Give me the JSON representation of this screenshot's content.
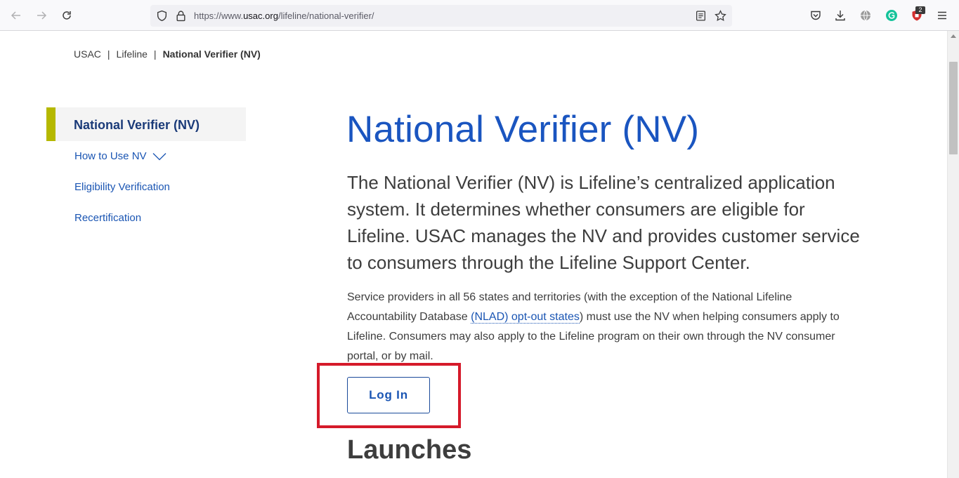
{
  "browser": {
    "url_prefix": "https://www.",
    "url_host": "usac.org",
    "url_path": "/lifeline/national-verifier/",
    "extension_badge": "2"
  },
  "breadcrumb": {
    "items": [
      "USAC",
      "Lifeline"
    ],
    "separator": "|",
    "current": "National Verifier (NV)"
  },
  "sidenav": {
    "active": "National Verifier (NV)",
    "items": [
      {
        "label": "How to Use NV"
      },
      {
        "label": "Eligibility Verification"
      },
      {
        "label": "Recertification"
      }
    ]
  },
  "main": {
    "title": "National Verifier (NV)",
    "lead": "The National Verifier (NV) is Lifeline’s centralized application system. It determines whether consumers are eligible for Lifeline. USAC manages the NV and provides customer service to consumers through the Lifeline Support Center.",
    "body_before_link": "Service providers in all 56 states and territories (with the exception of the National Lifeline Accountability Database ",
    "body_link": "(NLAD) opt-out states",
    "body_after_link": ") must use the NV when helping consumers apply to Lifeline. Consumers may also apply to the Lifeline program on their own through the NV consumer portal, or by mail.",
    "login_label": "Log In",
    "section_heading": "Launches"
  },
  "colors": {
    "accent_bar": "#b5b800",
    "title_blue": "#1a55c0",
    "link_blue": "#1a55b3",
    "highlight_red": "#d51a2a"
  }
}
